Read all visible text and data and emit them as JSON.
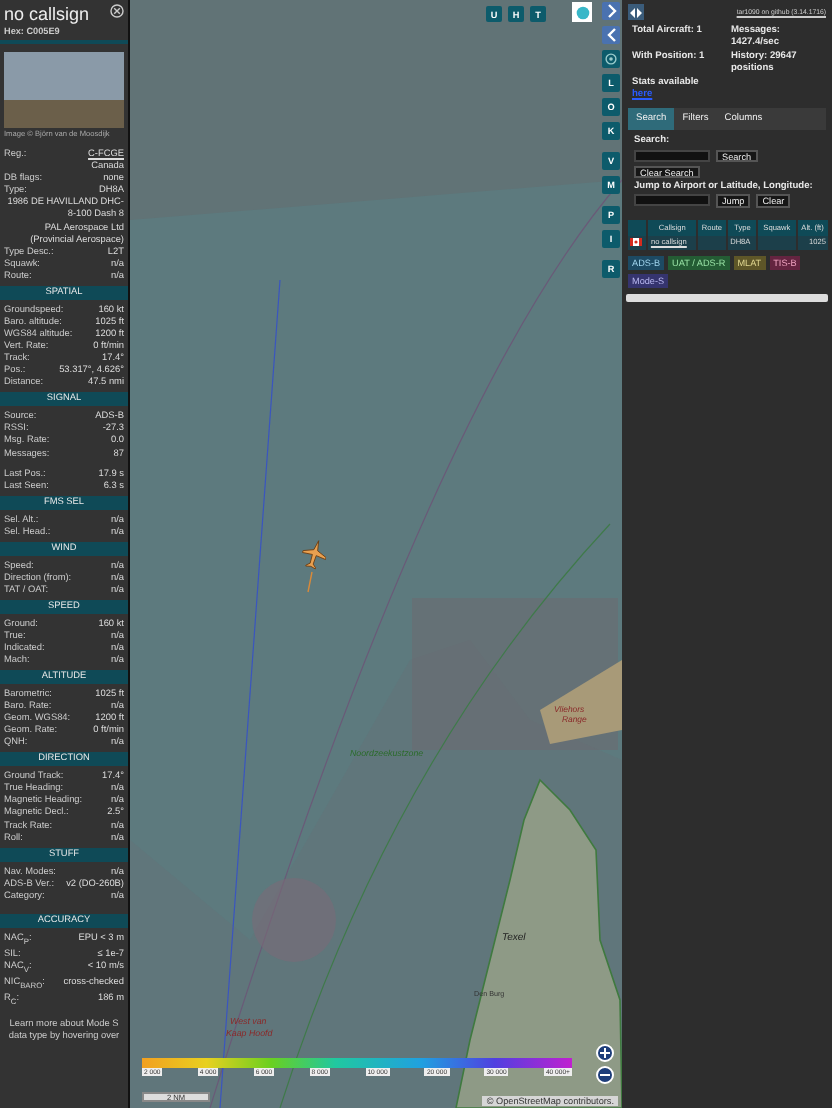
{
  "info_panel": {
    "callsign": "no callsign",
    "hex": "Hex: C005E9",
    "photo_caption": "Image © Björn van de Moosdijk",
    "details": [
      {
        "label": "Reg.:",
        "value": "C-FCGE",
        "kind": "link"
      },
      {
        "value": "Canada",
        "kind": "text"
      },
      {
        "label": "DB flags:",
        "value": "none",
        "kind": "text"
      },
      {
        "label": "Type:",
        "value": "DH8A",
        "kind": "text"
      },
      {
        "value": "1986 DE HAVILLAND DHC-8-100 Dash 8",
        "kind": "text"
      },
      {
        "value": "PAL Aerospace Ltd (Provincial Aerospace)",
        "kind": "text"
      },
      {
        "label": "Type Desc.:",
        "value": "L2T",
        "kind": "text"
      },
      {
        "label": "Squawk:",
        "value": "n/a",
        "kind": "text"
      },
      {
        "label": "Route:",
        "value": "n/a",
        "kind": "text"
      }
    ],
    "sections": [
      {
        "title": "SPATIAL",
        "rows": [
          {
            "label": "Groundspeed:",
            "value": "160 kt"
          },
          {
            "label": "Baro. altitude:",
            "value": "1025 ft"
          },
          {
            "label": "WGS84 altitude:",
            "value": "1200 ft"
          },
          {
            "label": "Vert. Rate:",
            "value": "0 ft/min"
          },
          {
            "label": "Track:",
            "value": "17.4°"
          },
          {
            "label": "Pos.:",
            "value": "53.317°, 4.626°"
          },
          {
            "label": "Distance:",
            "value": "47.5 nmi"
          }
        ]
      },
      {
        "title": "SIGNAL",
        "rows": [
          {
            "label": "Source:",
            "value": "ADS-B"
          },
          {
            "label": "RSSI:",
            "value": "-27.3"
          },
          {
            "label": "Msg. Rate:",
            "value": "0.0"
          },
          {
            "label": "Messages:",
            "value": "87"
          },
          {
            "label": "Last Pos.:",
            "value": "17.9 s",
            "spaced": true
          },
          {
            "label": "Last Seen:",
            "value": "6.3 s"
          }
        ]
      },
      {
        "title": "FMS SEL",
        "rows": [
          {
            "label": "Sel. Alt.:",
            "value": "n/a"
          },
          {
            "label": "Sel. Head.:",
            "value": "n/a"
          }
        ]
      },
      {
        "title": "WIND",
        "rows": [
          {
            "label": "Speed:",
            "value": "n/a"
          },
          {
            "label": "Direction (from):",
            "value": "n/a"
          },
          {
            "label": "TAT / OAT:",
            "value": "n/a"
          }
        ]
      },
      {
        "title": "SPEED",
        "rows": [
          {
            "label": "Ground:",
            "value": "160 kt"
          },
          {
            "label": "True:",
            "value": "n/a"
          },
          {
            "label": "Indicated:",
            "value": "n/a"
          },
          {
            "label": "Mach:",
            "value": "n/a"
          }
        ]
      },
      {
        "title": "ALTITUDE",
        "rows": [
          {
            "label": "Barometric:",
            "value": "1025 ft"
          },
          {
            "label": "Baro. Rate:",
            "value": "n/a"
          },
          {
            "label": "Geom. WGS84:",
            "value": "1200 ft"
          },
          {
            "label": "Geom. Rate:",
            "value": "0 ft/min"
          },
          {
            "label": "QNH:",
            "value": "n/a"
          }
        ]
      },
      {
        "title": "DIRECTION",
        "rows": [
          {
            "label": "Ground Track:",
            "value": "17.4°"
          },
          {
            "label": "True Heading:",
            "value": "n/a"
          },
          {
            "label": "Magnetic Heading:",
            "value": "n/a"
          },
          {
            "label": "Magnetic Decl.:",
            "value": "2.5°"
          },
          {
            "label": "Track Rate:",
            "value": "n/a"
          },
          {
            "label": "Roll:",
            "value": "n/a"
          }
        ]
      },
      {
        "title": "STUFF",
        "rows": [
          {
            "label": "Nav. Modes:",
            "value": "n/a"
          },
          {
            "label": "ADS-B Ver.:",
            "value": "v2 (DO-260B)"
          },
          {
            "label": "Category:",
            "value": "n/a"
          }
        ]
      },
      {
        "title": "ACCURACY",
        "spaced": true,
        "rows": [
          {
            "label": "NAC$_{P}$:",
            "value": "EPU < 3 m"
          },
          {
            "label": "SIL:",
            "value": "≤ 1e-7"
          },
          {
            "label": "NAC$_{V}$:",
            "value": "< 10 m/s"
          },
          {
            "label": "NIC$_{BARO}$:",
            "value": "cross-checked"
          },
          {
            "label": "R$_{C}$:",
            "value": "186 m"
          }
        ]
      }
    ],
    "footer": "Learn more about Mode S data type by hovering over"
  },
  "map": {
    "layer_buttons": [
      "U",
      "H",
      "T"
    ],
    "side_buttons": [
      {
        "label": "L"
      },
      {
        "label": "O"
      },
      {
        "label": "K"
      },
      {
        "label": "V",
        "spaced": true
      },
      {
        "label": "M"
      },
      {
        "label": "P",
        "spaced": true
      },
      {
        "label": "I"
      },
      {
        "label": "R",
        "spaced": true
      }
    ],
    "labels": [
      {
        "text": "Noordzeekustzone",
        "kind": "area"
      },
      {
        "text": "Texel",
        "kind": "island"
      },
      {
        "text": "Den Burg",
        "kind": "town"
      },
      {
        "text": "Vliehors",
        "kind": "range"
      },
      {
        "text": "Range",
        "kind": "range"
      },
      {
        "text": "West van",
        "kind": "cape"
      },
      {
        "text": "Kaap Hoofd",
        "kind": "cape"
      }
    ],
    "altitude_legend": [
      "2 000",
      "4 000",
      "6 000",
      "8 000",
      "10 000",
      "20 000",
      "30 000",
      "40 000+"
    ],
    "scale": "2 NM",
    "attribution": "© OpenStreetMap contributors."
  },
  "side_panel": {
    "version_link": "tar1090 on github (3.14.1716)",
    "stats": [
      {
        "text": "Total Aircraft: 1"
      },
      {
        "text": "Messages: 1427.4/sec"
      },
      {
        "text": "With Position: 1"
      },
      {
        "text": "History: 29647 positions"
      }
    ],
    "stats_note": "Stats available",
    "stats_link": "here",
    "tabs": [
      {
        "label": "Search",
        "selected": true
      },
      {
        "label": "Filters",
        "selected": false
      },
      {
        "label": "Columns",
        "selected": false
      }
    ],
    "search_label": "Search:",
    "search_button": "Search",
    "clear_search_button": "Clear Search",
    "jump_label": "Jump to Airport or Latitude, Longitude:",
    "jump_button": "Jump",
    "clear_button": "Clear",
    "table": {
      "columns": [
        "Callsign",
        "Route",
        "Type",
        "Squawk",
        "Alt. (ft)"
      ],
      "rows": [
        {
          "callsign": "no callsign",
          "route": "",
          "type": "DH8A",
          "squawk": "",
          "altitude": "1025"
        }
      ]
    },
    "badges": [
      {
        "text": "ADS-B",
        "color": "#1d4a63"
      },
      {
        "text": "UAT / ADS-R",
        "color": "#245c34"
      },
      {
        "text": "MLAT",
        "color": "#5e5628"
      },
      {
        "text": "TIS-B",
        "color": "#642440"
      },
      {
        "text": "Mode-S",
        "color": "#35346e"
      }
    ]
  }
}
